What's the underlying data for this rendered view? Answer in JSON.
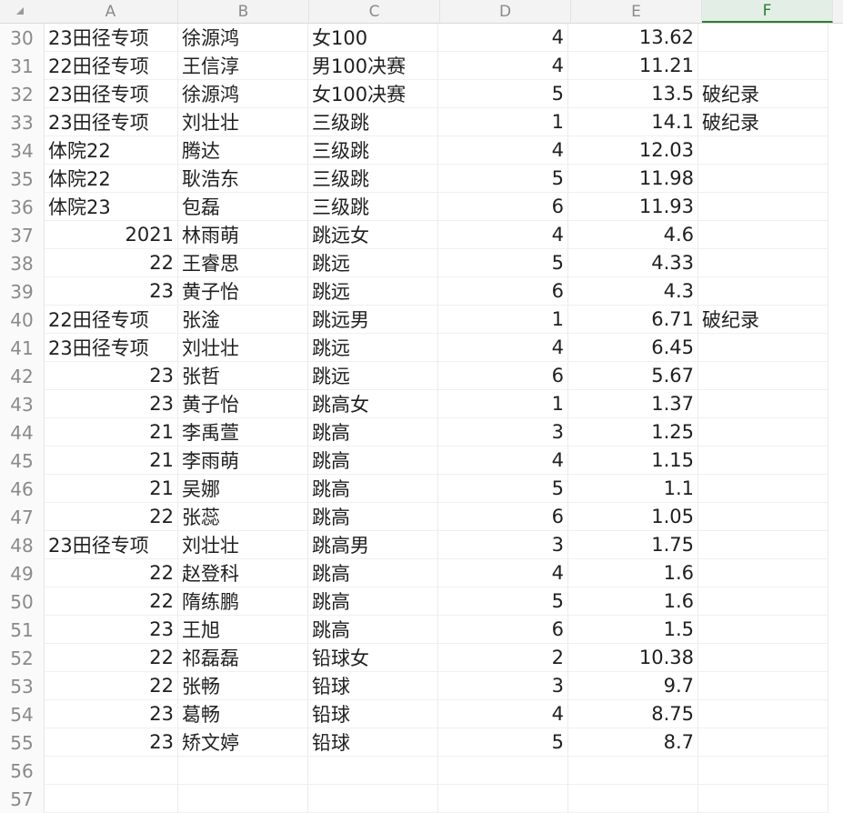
{
  "columns": [
    "A",
    "B",
    "C",
    "D",
    "E",
    "F"
  ],
  "rows": [
    {
      "n": "30",
      "a": "23田径专项",
      "b": "徐源鸿",
      "c": "女100",
      "d": "4",
      "e": "13.62",
      "f": ""
    },
    {
      "n": "31",
      "a": "22田径专项",
      "b": "王信淳",
      "c": "男100决赛",
      "d": "4",
      "e": "11.21",
      "f": ""
    },
    {
      "n": "32",
      "a": "23田径专项",
      "b": "徐源鸿",
      "c": "女100决赛",
      "d": "5",
      "e": "13.5",
      "f": "破纪录"
    },
    {
      "n": "33",
      "a": "23田径专项",
      "b": "刘壮壮",
      "c": "三级跳",
      "d": "1",
      "e": "14.1",
      "f": "破纪录"
    },
    {
      "n": "34",
      "a": "体院22",
      "b": "腾达",
      "c": "三级跳",
      "d": "4",
      "e": "12.03",
      "f": ""
    },
    {
      "n": "35",
      "a": "体院22",
      "b": "耿浩东",
      "c": "三级跳",
      "d": "5",
      "e": "11.98",
      "f": ""
    },
    {
      "n": "36",
      "a": "体院23",
      "b": "包磊",
      "c": "三级跳",
      "d": "6",
      "e": "11.93",
      "f": ""
    },
    {
      "n": "37",
      "a": "2021",
      "b": "林雨萌",
      "c": "跳远女",
      "d": "4",
      "e": "4.6",
      "f": ""
    },
    {
      "n": "38",
      "a": "22",
      "b": "王睿思",
      "c": "跳远",
      "d": "5",
      "e": "4.33",
      "f": ""
    },
    {
      "n": "39",
      "a": "23",
      "b": "黄子怡",
      "c": "跳远",
      "d": "6",
      "e": "4.3",
      "f": ""
    },
    {
      "n": "40",
      "a": "22田径专项",
      "b": "张淦",
      "c": "跳远男",
      "d": "1",
      "e": "6.71",
      "f": "破纪录"
    },
    {
      "n": "41",
      "a": "23田径专项",
      "b": "刘壮壮",
      "c": "跳远",
      "d": "4",
      "e": "6.45",
      "f": ""
    },
    {
      "n": "42",
      "a": "23",
      "b": "张哲",
      "c": "跳远",
      "d": "6",
      "e": "5.67",
      "f": ""
    },
    {
      "n": "43",
      "a": "23",
      "b": "黄子怡",
      "c": "跳高女",
      "d": "1",
      "e": "1.37",
      "f": ""
    },
    {
      "n": "44",
      "a": "21",
      "b": "李禹萱",
      "c": "跳高",
      "d": "3",
      "e": "1.25",
      "f": ""
    },
    {
      "n": "45",
      "a": "21",
      "b": "李雨萌",
      "c": "跳高",
      "d": "4",
      "e": "1.15",
      "f": ""
    },
    {
      "n": "46",
      "a": "21",
      "b": "吴娜",
      "c": "跳高",
      "d": "5",
      "e": "1.1",
      "f": ""
    },
    {
      "n": "47",
      "a": "22",
      "b": "张蕊",
      "c": "跳高",
      "d": "6",
      "e": "1.05",
      "f": ""
    },
    {
      "n": "48",
      "a": "23田径专项",
      "b": "刘壮壮",
      "c": "跳高男",
      "d": "3",
      "e": "1.75",
      "f": ""
    },
    {
      "n": "49",
      "a": "22",
      "b": "赵登科",
      "c": "跳高",
      "d": "4",
      "e": "1.6",
      "f": ""
    },
    {
      "n": "50",
      "a": "22",
      "b": "隋练鹏",
      "c": "跳高",
      "d": "5",
      "e": "1.6",
      "f": ""
    },
    {
      "n": "51",
      "a": "23",
      "b": "王旭",
      "c": "跳高",
      "d": "6",
      "e": "1.5",
      "f": ""
    },
    {
      "n": "52",
      "a": "22",
      "b": "祁磊磊",
      "c": "铅球女",
      "d": "2",
      "e": "10.38",
      "f": ""
    },
    {
      "n": "53",
      "a": "22",
      "b": "张畅",
      "c": "铅球",
      "d": "3",
      "e": "9.7",
      "f": ""
    },
    {
      "n": "54",
      "a": "23",
      "b": "葛畅",
      "c": "铅球",
      "d": "4",
      "e": "8.75",
      "f": ""
    },
    {
      "n": "55",
      "a": "23",
      "b": "矫文婷",
      "c": "铅球",
      "d": "5",
      "e": "8.7",
      "f": ""
    },
    {
      "n": "56",
      "a": "",
      "b": "",
      "c": "",
      "d": "",
      "e": "",
      "f": ""
    },
    {
      "n": "57",
      "a": "",
      "b": "",
      "c": "",
      "d": "",
      "e": "",
      "f": ""
    }
  ],
  "icons": {
    "corner": "select-all-triangle-icon"
  },
  "colors": {
    "selected_header": "#2e7d32"
  }
}
